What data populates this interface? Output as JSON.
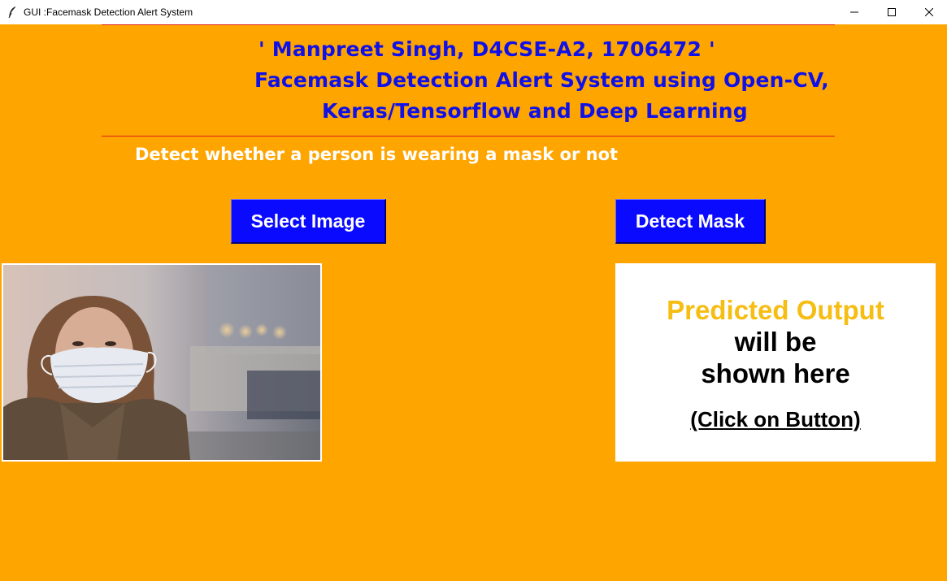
{
  "window": {
    "title": "GUI :Facemask Detection Alert System",
    "controls": {
      "minimize_icon": "minimize-icon",
      "maximize_icon": "maximize-icon",
      "close_icon": "close-icon"
    }
  },
  "header": {
    "line1": "' Manpreet Singh, D4CSE-A2, 1706472 '",
    "line2": "Facemask Detection Alert System using Open-CV,",
    "line3": "Keras/Tensorflow and Deep Learning"
  },
  "subtitle": "Detect whether a person is wearing a mask or not",
  "buttons": {
    "select_image": "Select Image",
    "detect_mask": "Detect Mask"
  },
  "output": {
    "line1": "Predicted Output",
    "line2": "will be",
    "line3": "shown here",
    "line4": "(Click on Button)"
  },
  "colors": {
    "background": "#ffa500",
    "heading": "#1010e8",
    "button": "#0a0aff",
    "predicted": "#f6bd12",
    "rule": "#e0201a"
  }
}
